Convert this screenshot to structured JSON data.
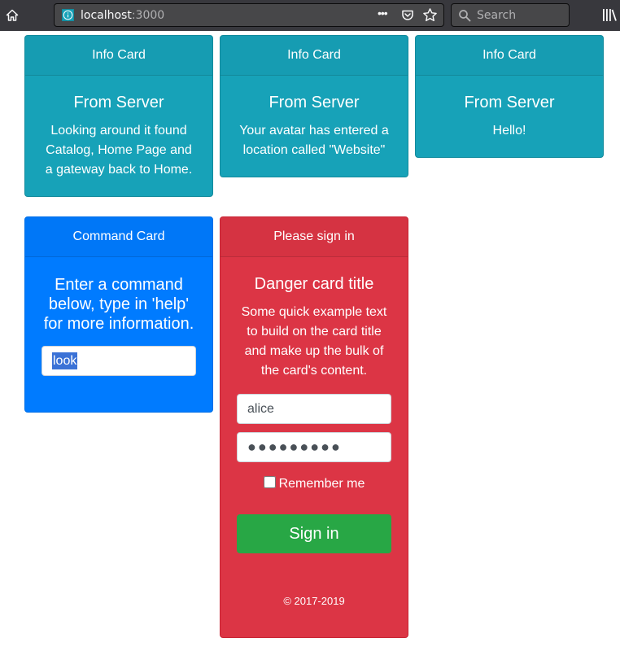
{
  "browser": {
    "url_host": "localhost",
    "url_port": ":3000",
    "more_label": "•••",
    "search_placeholder": "Search"
  },
  "info_cards": [
    {
      "header": "Info Card",
      "title": "From Server",
      "text": "Looking around it found Catalog, Home Page and a gateway back to Home."
    },
    {
      "header": "Info Card",
      "title": "From Server",
      "text": "Your avatar has entered a location called \"Website\""
    },
    {
      "header": "Info Card",
      "title": "From Server",
      "text": "Hello!"
    }
  ],
  "command_card": {
    "header": "Command Card",
    "title": "Enter a command below, type in 'help' for more information.",
    "input_value": "look"
  },
  "signin_card": {
    "header": "Please sign in",
    "title": "Danger card title",
    "text": "Some quick example text to build on the card title and make up the bulk of the card's content.",
    "username_value": "alice",
    "password_value": "●●●●●●●●●",
    "remember_label": "Remember me",
    "signin_label": "Sign in",
    "copyright": "© 2017-2019"
  },
  "colors": {
    "info": "#17a2b8",
    "primary": "#007bff",
    "danger": "#dc3545",
    "success": "#28a745",
    "toolbar": "#38383d"
  }
}
